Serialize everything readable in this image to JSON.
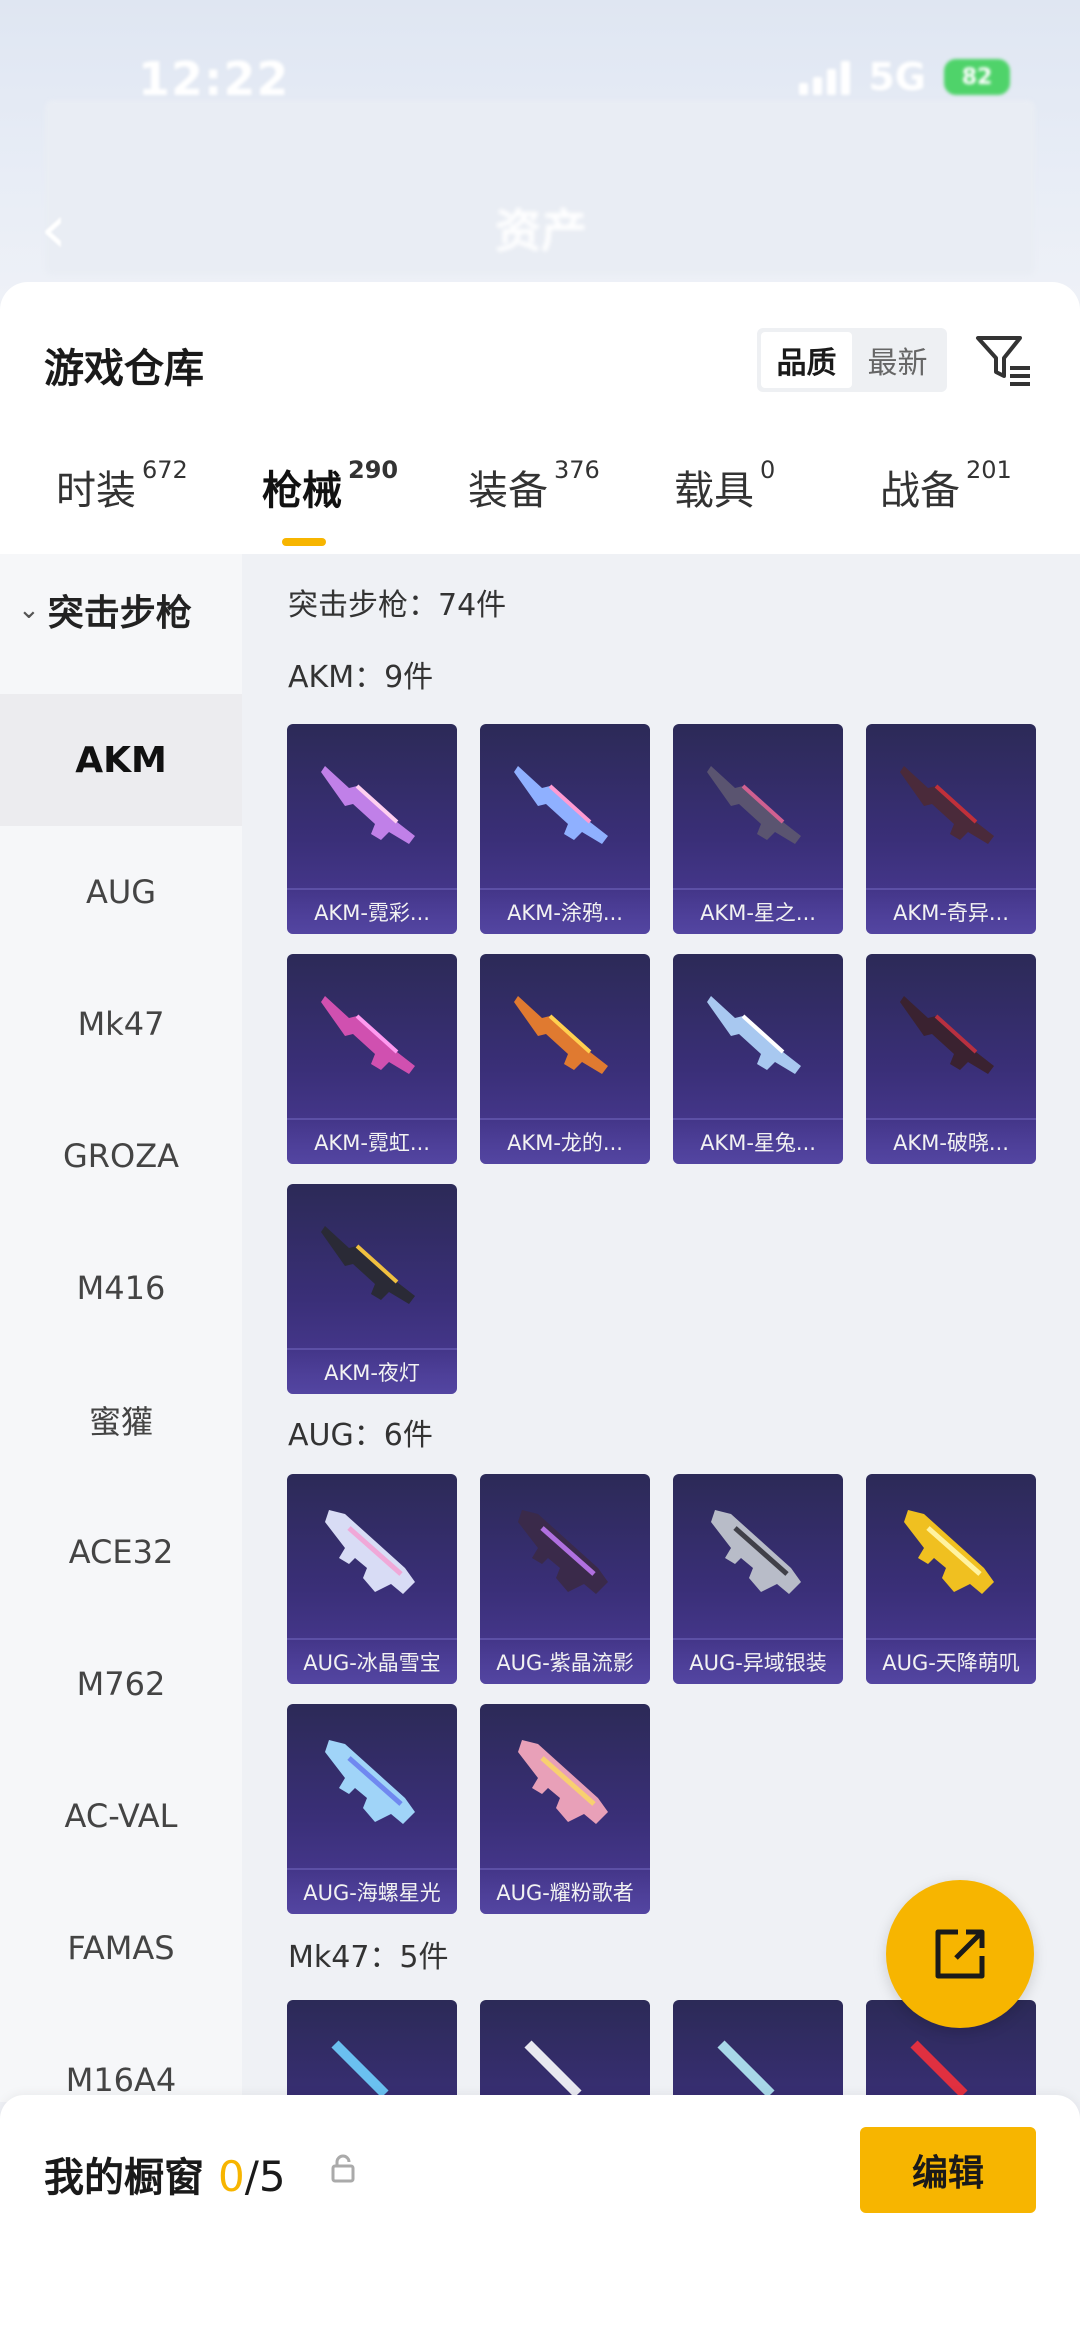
{
  "status_bar": {
    "time": "12:22",
    "network": "5G",
    "battery": "82"
  },
  "header": {
    "back_icon": "chevron-left-icon",
    "title": "资产"
  },
  "sheet": {
    "title": "游戏仓库",
    "sort_options": [
      "品质",
      "最新"
    ],
    "sort_selected": "品质",
    "filter_icon": "filter-icon"
  },
  "tabs": [
    {
      "label": "时装",
      "count": "672"
    },
    {
      "label": "枪械",
      "count": "290"
    },
    {
      "label": "装备",
      "count": "376"
    },
    {
      "label": "载具",
      "count": "0"
    },
    {
      "label": "战备",
      "count": "201"
    }
  ],
  "active_tab": "枪械",
  "sidebar": {
    "category": "突击步枪",
    "items": [
      "AKM",
      "AUG",
      "Mk47",
      "GROZA",
      "M416",
      "蜜獾",
      "ACE32",
      "M762",
      "AC-VAL",
      "FAMAS",
      "M16A4"
    ],
    "selected": "AKM"
  },
  "content": {
    "summary": "突击步枪：74件",
    "groups": [
      {
        "title": "AKM：9件",
        "items": [
          "AKM-霓彩...",
          "AKM-涂鸦...",
          "AKM-星之...",
          "AKM-奇异...",
          "AKM-霓虹...",
          "AKM-龙的...",
          "AKM-星兔...",
          "AKM-破晓...",
          "AKM-夜灯"
        ]
      },
      {
        "title": "AUG：6件",
        "items": [
          "AUG-冰晶雪宝",
          "AUG-紫晶流影",
          "AUG-异域银装",
          "AUG-天降萌叽",
          "AUG-海螺星光",
          "AUG-耀粉歌者"
        ]
      },
      {
        "title": "Mk47：5件",
        "items": [
          "",
          "",
          "",
          ""
        ]
      }
    ]
  },
  "colors": {
    "accent": "#f7b500",
    "card_bg": "#3a2f78"
  },
  "share_fab_icon": "share-out-icon",
  "bottom_bar": {
    "label": "我的橱窗",
    "count_current": "0",
    "count_total": "/5",
    "lock_icon": "lock-icon",
    "edit_label": "编辑"
  }
}
